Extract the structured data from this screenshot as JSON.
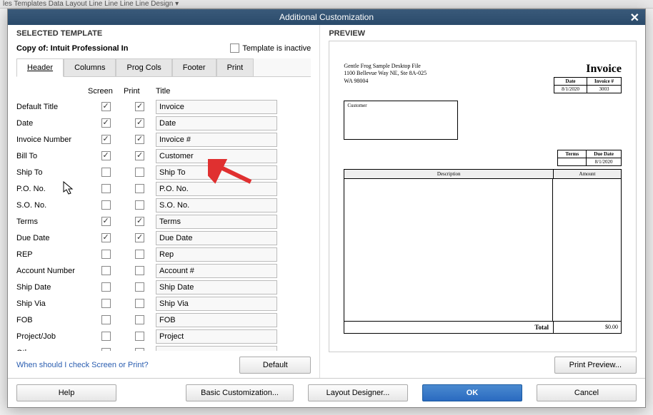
{
  "background": {
    "menu_items": "les  Templates  Data Layout         Line    Line    Line    Line                         Design ▾"
  },
  "dialog": {
    "title": "Additional Customization",
    "selected_template_label": "SELECTED TEMPLATE",
    "template_name": "Copy of: Intuit Professional In",
    "inactive_label": "Template is inactive",
    "preview_label": "PREVIEW",
    "tabs": [
      "Header",
      "Columns",
      "Prog Cols",
      "Footer",
      "Print"
    ],
    "columns": {
      "screen": "Screen",
      "print": "Print",
      "title": "Title"
    },
    "fields": [
      {
        "label": "Default Title",
        "screen": true,
        "print": true,
        "title": "Invoice"
      },
      {
        "label": "Date",
        "screen": true,
        "print": true,
        "title": "Date"
      },
      {
        "label": "Invoice Number",
        "screen": true,
        "print": true,
        "title": "Invoice #"
      },
      {
        "label": "Bill To",
        "screen": true,
        "print": true,
        "title": "Customer"
      },
      {
        "label": "Ship To",
        "screen": false,
        "print": false,
        "title": "Ship To"
      },
      {
        "label": "P.O. No.",
        "screen": false,
        "print": false,
        "title": "P.O. No."
      },
      {
        "label": "S.O. No.",
        "screen": false,
        "print": false,
        "title": "S.O. No."
      },
      {
        "label": "Terms",
        "screen": true,
        "print": true,
        "title": "Terms"
      },
      {
        "label": "Due Date",
        "screen": true,
        "print": true,
        "title": "Due Date"
      },
      {
        "label": "REP",
        "screen": false,
        "print": false,
        "title": "Rep"
      },
      {
        "label": "Account Number",
        "screen": false,
        "print": false,
        "title": "Account #"
      },
      {
        "label": "Ship Date",
        "screen": false,
        "print": false,
        "title": "Ship Date"
      },
      {
        "label": "Ship Via",
        "screen": false,
        "print": false,
        "title": "Ship Via"
      },
      {
        "label": "FOB",
        "screen": false,
        "print": false,
        "title": "FOB"
      },
      {
        "label": "Project/Job",
        "screen": false,
        "print": false,
        "title": "Project"
      },
      {
        "label": "Other",
        "screen": false,
        "print": false,
        "title": ""
      }
    ],
    "help_link": "When should I check Screen or Print?",
    "buttons": {
      "default": "Default",
      "help": "Help",
      "basic": "Basic Customization...",
      "layout": "Layout Designer...",
      "ok": "OK",
      "cancel": "Cancel",
      "print_preview": "Print Preview..."
    }
  },
  "preview": {
    "company": {
      "name": "Gentle Frog Sample Desktop File",
      "addr1": "1100 Bellevue Way NE, Ste 8A-025",
      "addr2": "WA 98004"
    },
    "doc_title": "Invoice",
    "date_hdr": "Date",
    "inv_hdr": "Invoice #",
    "date_val": "8/1/2020",
    "inv_val": "3003",
    "customer_box": "Customer",
    "terms_hdr": "Terms",
    "due_hdr": "Due Date",
    "due_val": "8/1/2020",
    "desc_hdr": "Description",
    "amt_hdr": "Amount",
    "total_label": "Total",
    "total_val": "$0.00"
  }
}
